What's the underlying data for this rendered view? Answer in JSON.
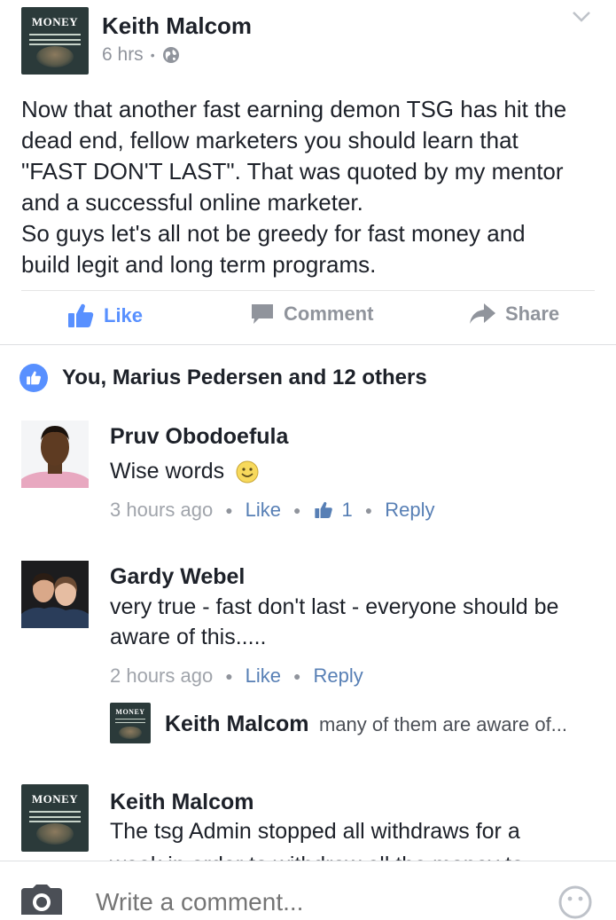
{
  "post": {
    "author": "Keith Malcom",
    "time": "6 hrs",
    "separator": "•",
    "avatar_text": "MONEY",
    "body": "Now that another fast earning demon TSG has hit the\ndead end, fellow marketers you should learn that\n\"FAST DON'T LAST\". That was quoted by my mentor\nand a successful online marketer.\nSo guys let's all not be greedy for fast money and\nbuild legit and long term programs."
  },
  "actions": {
    "like_label": "Like",
    "comment_label": "Comment",
    "share_label": "Share"
  },
  "likes": {
    "text": "You, Marius Pedersen and 12 others"
  },
  "comments": [
    {
      "name": "Pruv Obodoefula",
      "text": "Wise words",
      "time": "3 hours ago",
      "like_label": "Like",
      "reaction_count": "1",
      "reply_label": "Reply"
    },
    {
      "name": "Gardy Webel",
      "text": "very true - fast don't last - everyone should be aware of this.....",
      "time": "2 hours ago",
      "like_label": "Like",
      "reply_label": "Reply",
      "reply": {
        "name": "Keith Malcom",
        "text": "many of them are aware of..."
      }
    },
    {
      "name": "Keith Malcom",
      "text": "The tsg Admin stopped all withdraws for a",
      "text_overflow": "week in order to withdraw all the money to"
    }
  ],
  "composer": {
    "placeholder": "Write a comment..."
  },
  "colors": {
    "accent": "#5890ff",
    "link": "#577fb5",
    "muted": "#90949c",
    "text": "#1d2129"
  }
}
